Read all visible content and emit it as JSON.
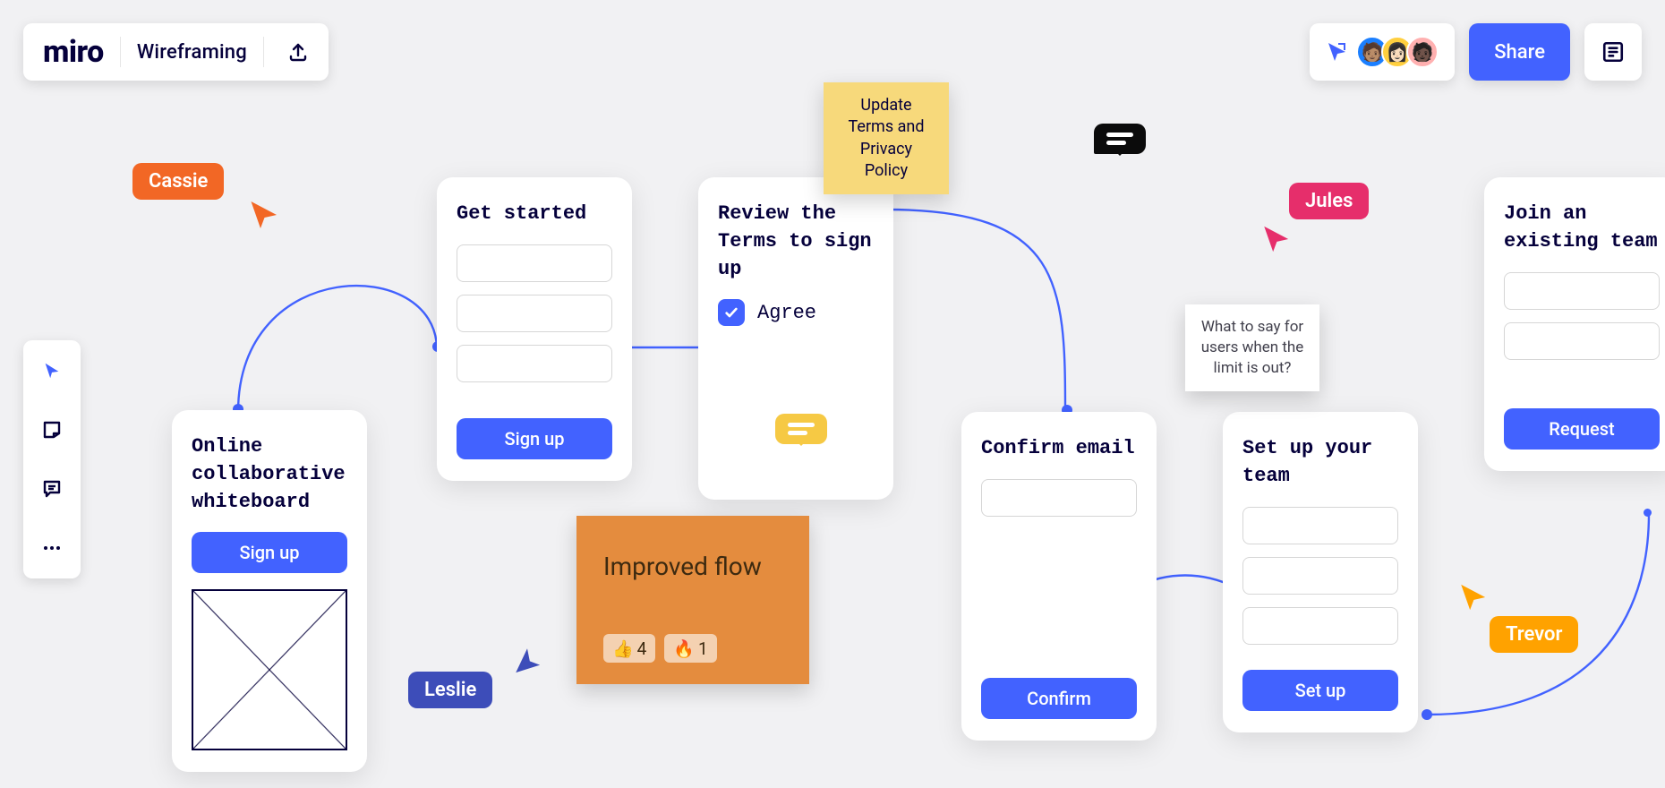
{
  "app": {
    "logo": "miro",
    "board_name": "Wireframing"
  },
  "share_label": "Share",
  "cursors": {
    "cassie": "Cassie",
    "leslie": "Leslie",
    "jules": "Jules",
    "trevor": "Trevor"
  },
  "stickies": {
    "terms": "Update Terms and Privacy Policy",
    "limit": "What to say for users when the limit is out?",
    "improved": "Improved flow"
  },
  "reactions": {
    "thumbs": "4",
    "fire": "1"
  },
  "panels": {
    "p1": {
      "title": "Online collaborative whiteboard",
      "button": "Sign up"
    },
    "p2": {
      "title": "Get started",
      "button": "Sign up"
    },
    "p3": {
      "title": "Review the Terms to sign up",
      "agree": "Agree"
    },
    "p4": {
      "title": "Confirm email",
      "button": "Confirm"
    },
    "p5": {
      "title": "Set up your team",
      "button": "Set up"
    },
    "p6": {
      "title": "Join an existing team",
      "button": "Request"
    }
  }
}
